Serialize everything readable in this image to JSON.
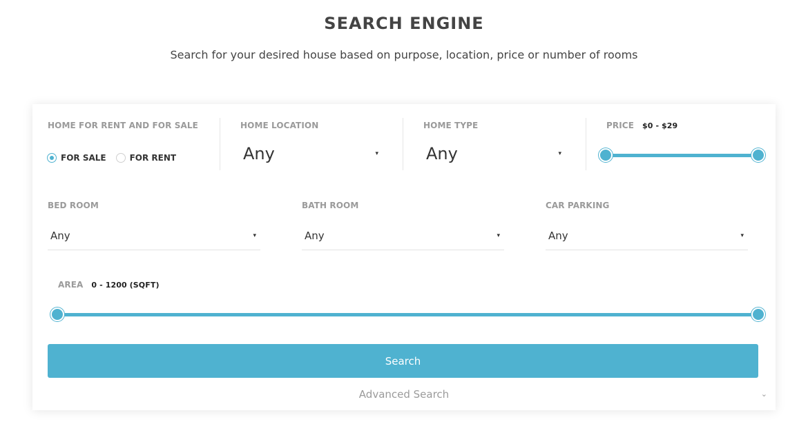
{
  "header": {
    "title": "SEARCH ENGINE",
    "subtitle": "Search for your desired house based on purpose, location, price or number of rooms"
  },
  "purpose": {
    "label": "HOME FOR RENT AND FOR SALE",
    "options": [
      {
        "label": "FOR SALE",
        "checked": true
      },
      {
        "label": "FOR RENT",
        "checked": false
      }
    ]
  },
  "location": {
    "label": "HOME LOCATION",
    "value": "Any"
  },
  "type": {
    "label": "HOME TYPE",
    "value": "Any"
  },
  "price": {
    "label": "PRICE",
    "range_text": "$0 - $29",
    "min_fraction": 0,
    "max_fraction": 1
  },
  "bed_room": {
    "label": "BED ROOM",
    "value": "Any"
  },
  "bath_room": {
    "label": "BATH ROOM",
    "value": "Any"
  },
  "car_parking": {
    "label": "CAR PARKING",
    "value": "Any"
  },
  "area": {
    "label": "AREA",
    "range_text": "0 - 1200 (SQFT)",
    "min_fraction": 0,
    "max_fraction": 1
  },
  "actions": {
    "search_label": "Search",
    "advanced_label": "Advanced Search"
  },
  "icons": {
    "caret": "▾",
    "chevron": "⌄"
  },
  "colors": {
    "accent": "#4fb2d0"
  }
}
